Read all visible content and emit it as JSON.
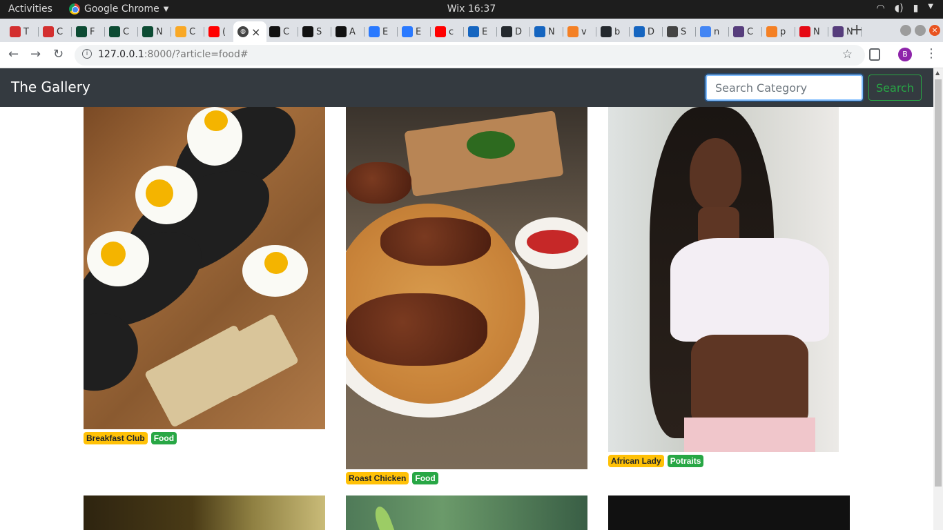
{
  "os": {
    "activities": "Activities",
    "app_name": "Google Chrome",
    "clock": "Wix 16:37"
  },
  "browser": {
    "tabs": [
      {
        "icon": "opera-icon",
        "label": "T",
        "color": "#d32f2f"
      },
      {
        "icon": "opera-icon",
        "label": "C",
        "color": "#d32f2f"
      },
      {
        "icon": "django-icon",
        "label": "F",
        "color": "#0c4b33"
      },
      {
        "icon": "django-icon",
        "label": "C",
        "color": "#0c4b33"
      },
      {
        "icon": "django-icon",
        "label": "N",
        "color": "#0c4b33"
      },
      {
        "icon": "bulb-icon",
        "label": "C",
        "color": "#f9a825"
      },
      {
        "icon": "youtube-icon",
        "label": "(",
        "color": "#ff0000"
      },
      {
        "icon": "codepen-icon",
        "label": "C",
        "color": "#111111"
      },
      {
        "icon": "codepen-icon",
        "label": "S",
        "color": "#111111"
      },
      {
        "icon": "codepen-icon",
        "label": "A",
        "color": "#111111"
      },
      {
        "icon": "bootstrap-icon",
        "label": "E",
        "color": "#2979ff"
      },
      {
        "icon": "bootstrap-icon",
        "label": "E",
        "color": "#2979ff"
      },
      {
        "icon": "youtube-icon",
        "label": "c",
        "color": "#ff0000"
      },
      {
        "icon": "mdb-icon",
        "label": "E",
        "color": "#1565c0"
      },
      {
        "icon": "github-icon",
        "label": "D",
        "color": "#24292e"
      },
      {
        "icon": "mdb-icon",
        "label": "N",
        "color": "#1565c0"
      },
      {
        "icon": "stackoverflow-icon",
        "label": "v",
        "color": "#f48024"
      },
      {
        "icon": "github-icon",
        "label": "b",
        "color": "#24292e"
      },
      {
        "icon": "mdb-icon",
        "label": "D",
        "color": "#1565c0"
      },
      {
        "icon": "blank-icon",
        "label": "S",
        "color": "#444444"
      },
      {
        "icon": "google-icon",
        "label": "n",
        "color": "#4285f4"
      },
      {
        "icon": "bootstrap-b-icon",
        "label": "C",
        "color": "#563d7c"
      },
      {
        "icon": "stackoverflow-icon",
        "label": "p",
        "color": "#f48024"
      },
      {
        "icon": "netflix-icon",
        "label": "N",
        "color": "#e50914"
      },
      {
        "icon": "bootstrap-b-icon",
        "label": "N",
        "color": "#563d7c"
      }
    ],
    "active_tab_close": "×",
    "url_host": "127.0.0.1",
    "url_rest": ":8000/?article=food#",
    "profile_initial": "B"
  },
  "site": {
    "brand": "The Gallery",
    "search_placeholder": "Search Category",
    "search_button": "Search"
  },
  "gallery": [
    {
      "title": "Breakfast Club",
      "category": "Food"
    },
    {
      "title": "Roast Chicken",
      "category": "Food"
    },
    {
      "title": "African Lady",
      "category": "Potraits"
    }
  ],
  "colors": {
    "navbar": "#343a40",
    "badge_warning": "#ffc107",
    "badge_success": "#28a745"
  }
}
